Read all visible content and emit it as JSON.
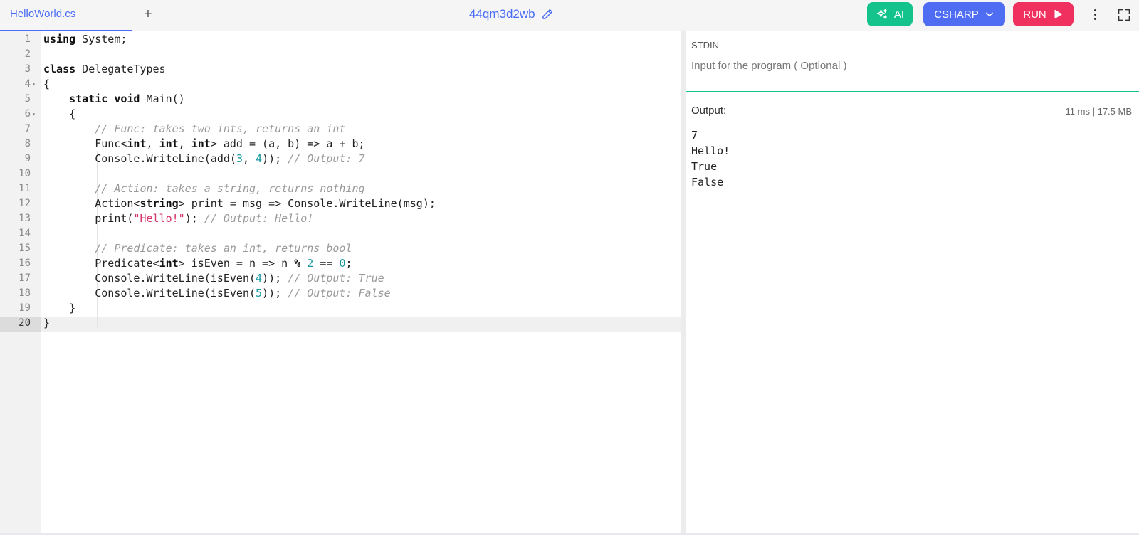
{
  "tabs": [
    {
      "label": "HelloWorld.cs"
    }
  ],
  "add_tab_label": "+",
  "project": {
    "name": "44qm3d2wb"
  },
  "toolbar": {
    "ai_label": "AI",
    "language_label": "CSHARP",
    "run_label": "RUN"
  },
  "editor": {
    "lines": [
      {
        "n": "1",
        "html": "<span class=\"kw\">using</span> System;"
      },
      {
        "n": "2",
        "html": ""
      },
      {
        "n": "3",
        "html": "<span class=\"kw\">class</span> DelegateTypes"
      },
      {
        "n": "4",
        "html": "{",
        "fold": true
      },
      {
        "n": "5",
        "html": "    <span class=\"kw\">static</span> <span class=\"kw\">void</span> Main()"
      },
      {
        "n": "6",
        "html": "    {",
        "fold": true
      },
      {
        "n": "7",
        "html": "        <span class=\"cm\">// Func: takes two ints, returns an int</span>"
      },
      {
        "n": "8",
        "html": "        Func&lt;<span class=\"kw\">int</span>, <span class=\"kw\">int</span>, <span class=\"kw\">int</span>&gt; add = (a, b) =&gt; a + b;"
      },
      {
        "n": "9",
        "html": "        Console.WriteLine(add(<span class=\"num\">3</span>, <span class=\"num\">4</span>)); <span class=\"cm\">// Output: 7</span>"
      },
      {
        "n": "10",
        "html": ""
      },
      {
        "n": "11",
        "html": "        <span class=\"cm\">// Action: takes a string, returns nothing</span>"
      },
      {
        "n": "12",
        "html": "        Action&lt;<span class=\"kw\">string</span>&gt; print = msg =&gt; Console.WriteLine(msg);"
      },
      {
        "n": "13",
        "html": "        print(<span class=\"str\">\"Hello!\"</span>); <span class=\"cm\">// Output: Hello!</span>"
      },
      {
        "n": "14",
        "html": ""
      },
      {
        "n": "15",
        "html": "        <span class=\"cm\">// Predicate: takes an int, returns bool</span>"
      },
      {
        "n": "16",
        "html": "        Predicate&lt;<span class=\"kw\">int</span>&gt; isEven = n =&gt; n <span class=\"kw\">%</span> <span class=\"num\">2</span> == <span class=\"num\">0</span>;"
      },
      {
        "n": "17",
        "html": "        Console.WriteLine(isEven(<span class=\"num\">4</span>)); <span class=\"cm\">// Output: True</span>"
      },
      {
        "n": "18",
        "html": "        Console.WriteLine(isEven(<span class=\"num\">5</span>)); <span class=\"cm\">// Output: False</span>"
      },
      {
        "n": "19",
        "html": "    }"
      },
      {
        "n": "20",
        "html": "}"
      }
    ],
    "active_line": "20"
  },
  "stdin": {
    "label": "STDIN",
    "placeholder": "Input for the program ( Optional )"
  },
  "output": {
    "label": "Output:",
    "stats": "11 ms | 17.5 MB",
    "lines": [
      "7",
      "Hello!",
      "True",
      "False"
    ]
  },
  "colors": {
    "accent": "#4a6cf7",
    "ai": "#13c38b",
    "language": "#4e6df3",
    "run": "#f0305f"
  },
  "icons": {
    "ai": "sparkles-icon",
    "language": "chevron-down-icon",
    "run": "play-icon",
    "project": "pencil-icon",
    "menu": "kebab-menu-icon",
    "fullscreen": "fullscreen-icon"
  }
}
